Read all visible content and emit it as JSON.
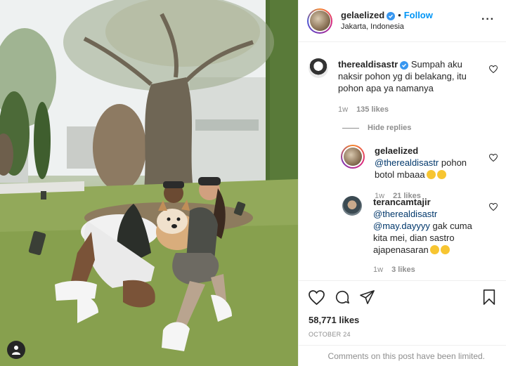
{
  "post": {
    "username": "gelaelized",
    "follow_label": "Follow",
    "location": "Jakarta, Indonesia",
    "dot": "•",
    "more_label": "···"
  },
  "comments": [
    {
      "username": "therealdisastr",
      "verified": true,
      "text": "Sumpah aku naksir pohon yg di belakang, itu pohon apa ya namanya",
      "age": "1w",
      "likes": "135 likes"
    }
  ],
  "hide_replies_label": "Hide replies",
  "replies": [
    {
      "username": "gelaelized",
      "mention": "@therealdisastr",
      "text": "pohon botol mbaaa",
      "age": "1w",
      "likes": "21 likes"
    },
    {
      "username": "terancamtajir",
      "mention1": "@therealdisastr",
      "mention2": "@may.dayyyy",
      "text": "gak cuma kita mei, dian sastro ajapenasaran",
      "age": "1w",
      "likes": "3 likes"
    }
  ],
  "stats": {
    "likes": "58,771 likes",
    "date": "OCTOBER 24"
  },
  "comments_limited": "Comments on this post have been limited.",
  "colors": {
    "accent": "#0095f6",
    "verified": "#3897f0",
    "muted": "#8e8e8e",
    "text": "#262626"
  }
}
